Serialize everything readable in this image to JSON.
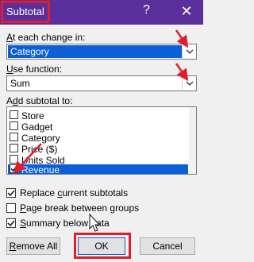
{
  "window": {
    "title": "Subtotal",
    "help_glyph": "?",
    "close_glyph": "✕",
    "title_bar_color": "#5b2f9b",
    "annotation_color": "#e11d2a"
  },
  "at_each_change": {
    "label_prefix": "",
    "label_key": "A",
    "label_rest": "t each change in:",
    "value": "Category"
  },
  "use_function": {
    "label_key": "U",
    "label_rest": "se function:",
    "value": "Sum"
  },
  "add_subtotal": {
    "label_pre": "A",
    "label_key": "d",
    "label_rest": "d subtotal to:",
    "items": [
      {
        "label": "Store",
        "checked": false,
        "selected": false
      },
      {
        "label": "Gadget",
        "checked": false,
        "selected": false
      },
      {
        "label": "Category",
        "checked": false,
        "selected": false
      },
      {
        "label": "Price ($)",
        "checked": false,
        "selected": false
      },
      {
        "label": "Units Sold",
        "checked": false,
        "selected": false
      },
      {
        "label": "Revenue",
        "checked": true,
        "selected": true
      }
    ]
  },
  "options": {
    "replace_pre": "Replace ",
    "replace_key": "c",
    "replace_rest": "urrent subtotals",
    "replace_checked": true,
    "pagebreak_key": "P",
    "pagebreak_rest": "age break between groups",
    "pagebreak_checked": false,
    "summary_key": "S",
    "summary_rest": "ummary below data",
    "summary_checked": true
  },
  "buttons": {
    "remove_key": "R",
    "remove_rest": "emove All",
    "ok": "OK",
    "cancel": "Cancel"
  }
}
